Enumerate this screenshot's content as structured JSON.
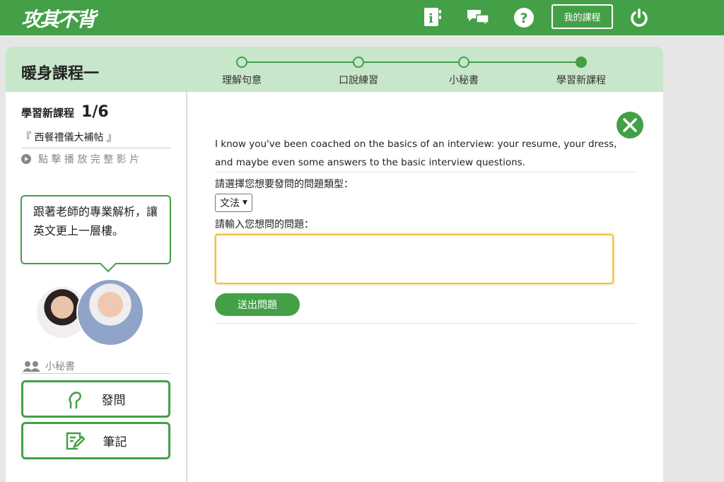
{
  "header": {
    "logo": "攻其不背",
    "my_courses": "我的課程"
  },
  "course": {
    "title": "暖身課程一",
    "steps": [
      {
        "label": "理解句意",
        "done": false
      },
      {
        "label": "口說練習",
        "done": false
      },
      {
        "label": "小秘書",
        "done": false
      },
      {
        "label": "學習新課程",
        "done": true
      }
    ]
  },
  "sidebar": {
    "section": "學習新課程",
    "progress": "1/6",
    "lesson": "『 西餐禮儀大補帖 』",
    "play": "點 擊 播 放 完 整 影 片",
    "bubble": "跟著老師的專業解析，讓英文更上一層樓。",
    "assistant": "小秘書",
    "ask": "發問",
    "notes": "筆記"
  },
  "main": {
    "sentence": "I know you've been coached on the basics of an interview: your resume, your dress, and maybe even some answers to the basic interview questions.",
    "type_label": "請選擇您想要發問的問題類型：",
    "type_value": "文法",
    "question_label": "請輸入您想問的問題：",
    "question_value": "",
    "submit": "送出問題"
  },
  "colors": {
    "primary": "#43a047",
    "band": "#c8e6c9",
    "input_border": "#f0c040"
  }
}
